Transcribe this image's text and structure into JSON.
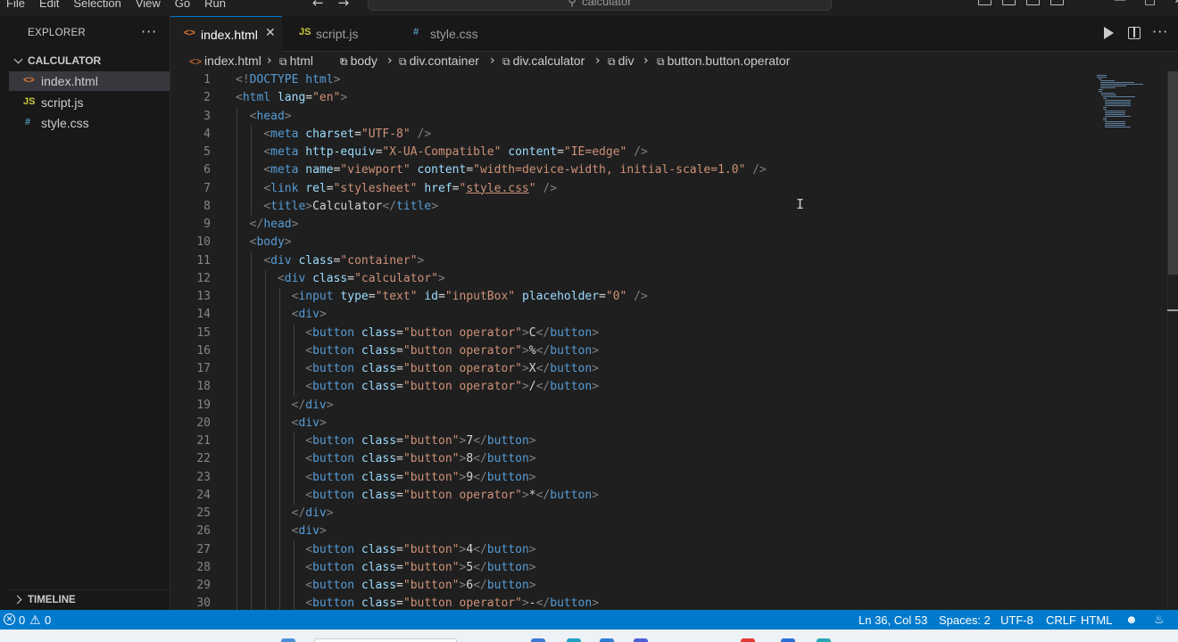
{
  "titlebar": {
    "menu": [
      "File",
      "Edit",
      "Selection",
      "View",
      "Go",
      "Run"
    ],
    "search_text": "calculator"
  },
  "sidebar": {
    "title": "EXPLORER",
    "folder": "CALCULATOR",
    "files": [
      {
        "name": "index.html",
        "icon": "<>",
        "icon_color": "#e37933",
        "active": true
      },
      {
        "name": "script.js",
        "icon": "JS",
        "icon_color": "#cbcb41",
        "active": false
      },
      {
        "name": "style.css",
        "icon": "#",
        "icon_color": "#519aba",
        "active": false
      }
    ],
    "timeline": "TIMELINE"
  },
  "tabs": [
    {
      "label": "index.html",
      "icon": "<>",
      "icon_color": "#e37933",
      "active": true
    },
    {
      "label": "script.js",
      "icon": "JS",
      "icon_color": "#cbcb41",
      "active": false
    },
    {
      "label": "style.css",
      "icon": "#",
      "icon_color": "#519aba",
      "active": false
    }
  ],
  "breadcrumb": [
    "index.html",
    "html",
    "body",
    "div.container",
    "div.calculator",
    "div",
    "button.button.operator"
  ],
  "editor": {
    "line_numbers": [
      "1",
      "2",
      "3",
      "4",
      "5",
      "6",
      "7",
      "8",
      "9",
      "10",
      "11",
      "12",
      "13",
      "14",
      "15",
      "16",
      "17",
      "18",
      "19",
      "20",
      "21",
      "22",
      "23",
      "24",
      "25",
      "26",
      "27",
      "28",
      "29",
      "30"
    ],
    "lines": [
      "<!DOCTYPE html>",
      "<html lang=\"en\">",
      "  <head>",
      "    <meta charset=\"UTF-8\" />",
      "    <meta http-equiv=\"X-UA-Compatible\" content=\"IE=edge\" />",
      "    <meta name=\"viewport\" content=\"width=device-width, initial-scale=1.0\" />",
      "    <link rel=\"stylesheet\" href=\"style.css\" />",
      "    <title>Calculator</title>",
      "  </head>",
      "  <body>",
      "    <div class=\"container\">",
      "      <div class=\"calculator\">",
      "        <input type=\"text\" id=\"inputBox\" placeholder=\"0\" />",
      "        <div>",
      "          <button class=\"button operator\">C</button>",
      "          <button class=\"button operator\">%</button>",
      "          <button class=\"button operator\">X</button>",
      "          <button class=\"button operator\">/</button>",
      "        </div>",
      "        <div>",
      "          <button class=\"button\">7</button>",
      "          <button class=\"button\">8</button>",
      "          <button class=\"button\">9</button>",
      "          <button class=\"button operator\">*</button>",
      "        </div>",
      "        <div>",
      "          <button class=\"button\">4</button>",
      "          <button class=\"button\">5</button>",
      "          <button class=\"button\">6</button>",
      "          <button class=\"button operator\">-</button>"
    ]
  },
  "statusbar": {
    "errors": "0",
    "warnings": "0",
    "position": "Ln 36, Col 53",
    "spaces": "Spaces: 2",
    "encoding": "UTF-8",
    "eol": "CRLF",
    "language": "HTML"
  },
  "colors": {
    "accent": "#007acc",
    "tag": "#569cd6",
    "attr": "#9cdcfe",
    "string": "#ce9178"
  }
}
